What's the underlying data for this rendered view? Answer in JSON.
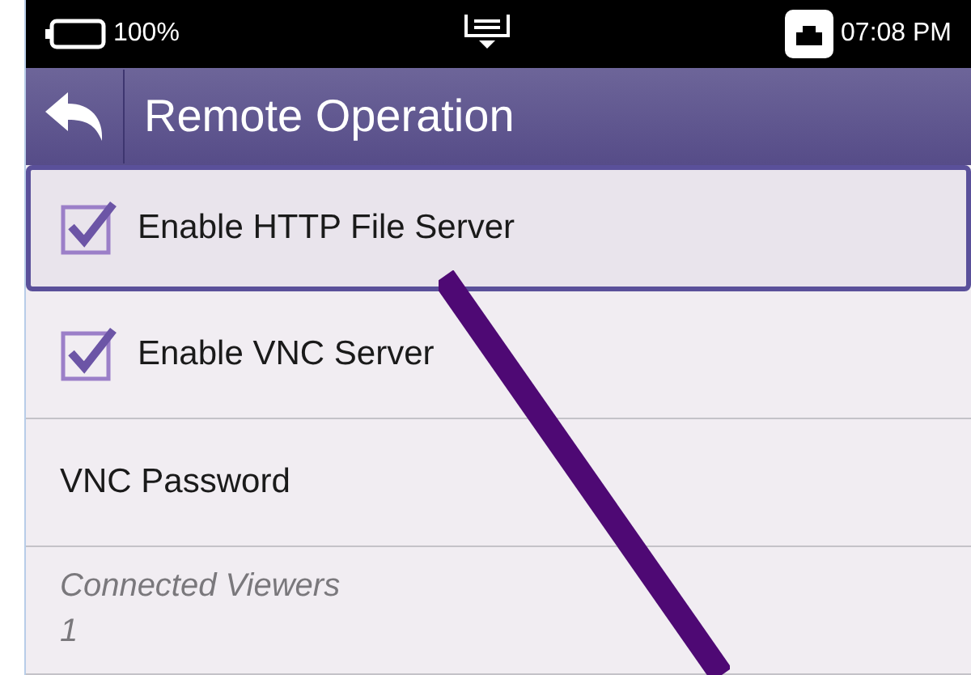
{
  "status_bar": {
    "battery": "100%",
    "time": "07:08 PM"
  },
  "header": {
    "title": "Remote Operation"
  },
  "items": [
    {
      "kind": "checkbox",
      "label": "Enable HTTP File Server",
      "checked": true,
      "focused": true
    },
    {
      "kind": "checkbox",
      "label": "Enable VNC Server",
      "checked": true,
      "focused": false
    },
    {
      "kind": "plain",
      "label": "VNC Password",
      "focused": false
    },
    {
      "kind": "info",
      "label": "Connected Viewers",
      "value": "1",
      "focused": false
    }
  ]
}
